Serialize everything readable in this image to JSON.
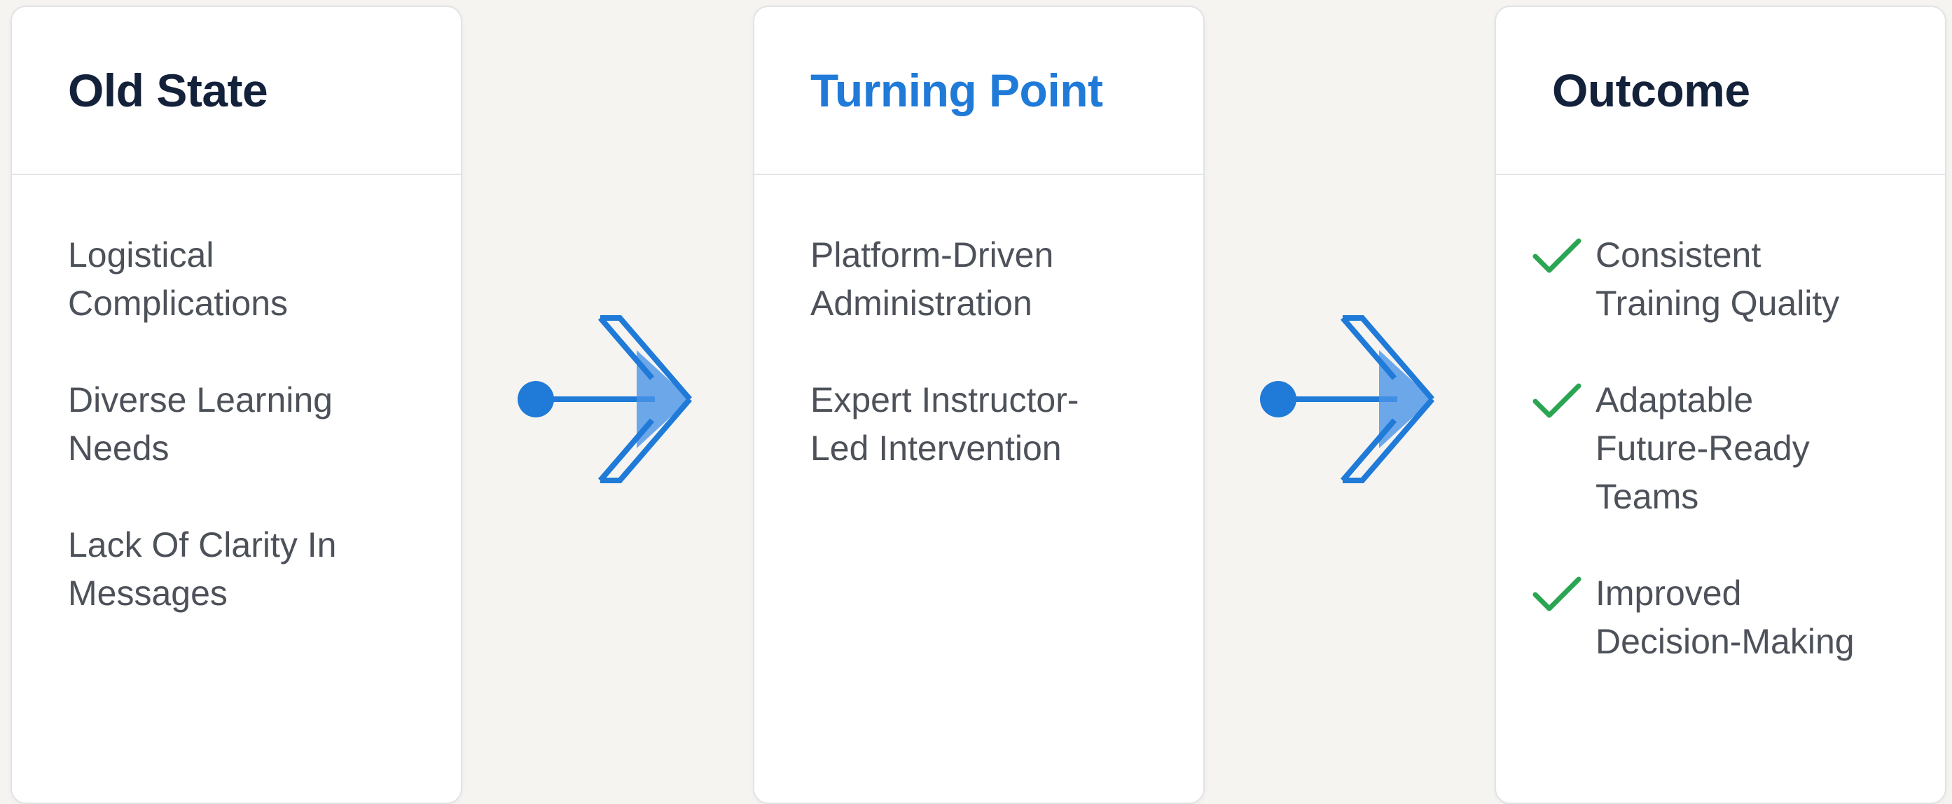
{
  "columns": {
    "old_state": {
      "title": "Old State",
      "items": [
        "Logistical\nComplications",
        "Diverse Learning\nNeeds",
        "Lack Of Clarity In\nMessages"
      ]
    },
    "turning_point": {
      "title": "Turning Point",
      "items": [
        "Platform-Driven\nAdministration",
        "Expert Instructor-\nLed Intervention"
      ]
    },
    "outcome": {
      "title": "Outcome",
      "items": [
        "Consistent\nTraining Quality",
        "Adaptable\nFuture-Ready\nTeams",
        "Improved\nDecision-Making"
      ]
    }
  },
  "colors": {
    "accent": "#1f7ad8",
    "check": "#2aa552",
    "title": "#14213a",
    "text": "#4d5159"
  },
  "icons": {
    "connector": "arrow-right-icon",
    "outcome_marker": "check-icon"
  }
}
